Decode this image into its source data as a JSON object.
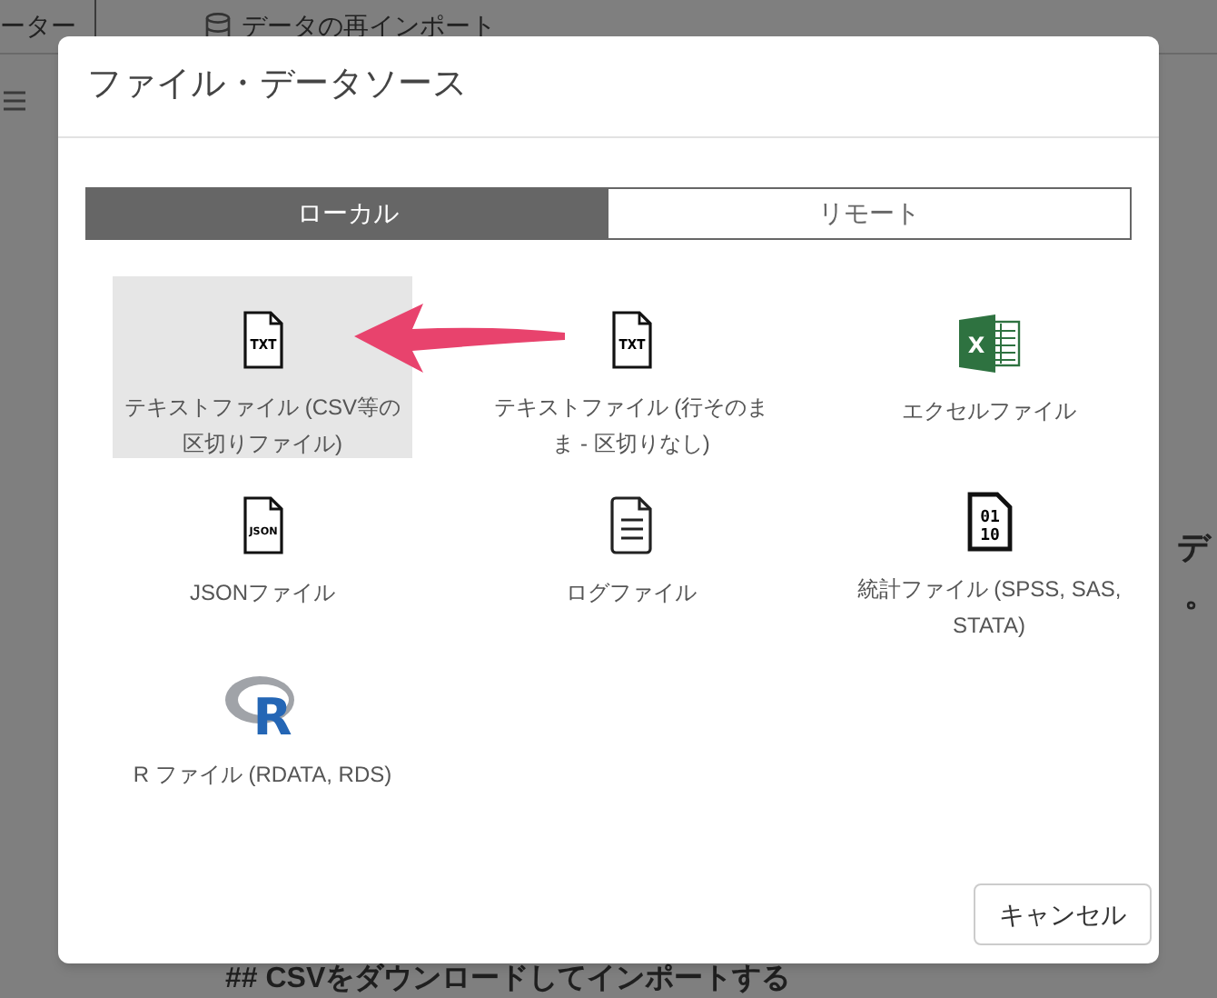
{
  "background": {
    "toolbar_items": [
      {
        "kind": "text",
        "label": "ーター"
      },
      {
        "kind": "database",
        "label": "データの再インポート"
      }
    ],
    "fragments": [
      "デ",
      "。"
    ],
    "heading": "## CSVをダウンロードしてインポートする"
  },
  "dialog": {
    "title": "ファイル・データソース",
    "tabs": [
      {
        "label": "ローカル",
        "selected": true
      },
      {
        "label": "リモート",
        "selected": false
      }
    ],
    "items": [
      {
        "kind": "txt",
        "icon_text": [
          "TXT"
        ],
        "label": "テキストファイル (CSV等の区切りファイル)",
        "selected": true
      },
      {
        "kind": "txt",
        "icon_text": [
          "TXT"
        ],
        "label": "テキストファイル (行そのまま - 区切りなし)",
        "selected": false
      },
      {
        "kind": "excel",
        "icon_text": [
          "X"
        ],
        "label": "エクセルファイル",
        "selected": false
      },
      {
        "kind": "json",
        "icon_text": [
          "JSON"
        ],
        "label": "JSONファイル",
        "selected": false
      },
      {
        "kind": "log",
        "label": "ログファイル",
        "selected": false
      },
      {
        "kind": "binary",
        "icon_text": [
          "01",
          "10"
        ],
        "label": "統計ファイル (SPSS, SAS, STATA)",
        "selected": false
      },
      {
        "kind": "r",
        "icon_text": [
          "R"
        ],
        "label": "R ファイル (RDATA, RDS)",
        "selected": false
      }
    ],
    "cancel": "キャンセル"
  }
}
